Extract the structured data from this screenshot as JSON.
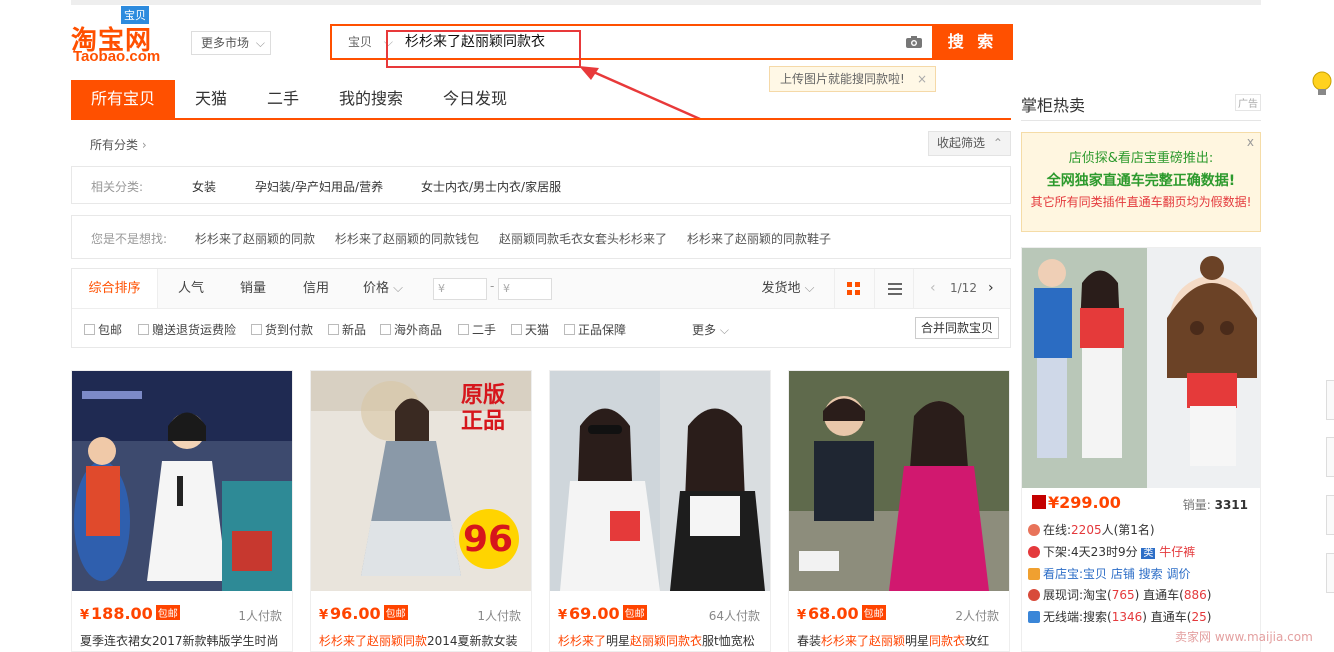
{
  "logo": {
    "cn": "淘宝网",
    "en": "Taobao.com",
    "tag": "宝贝"
  },
  "market_btn": "更多市场",
  "search": {
    "scope": "宝贝",
    "query": "杉杉来了赵丽颖同款衣",
    "button": "搜 索",
    "tip": "上传图片就能搜同款啦!",
    "tip_close": "×"
  },
  "tabs": [
    "所有宝贝",
    "天猫",
    "二手",
    "我的搜索",
    "今日发现"
  ],
  "crumb": "所有分类",
  "collapse": "收起筛选",
  "related": {
    "label": "相关分类:",
    "items": [
      "女装",
      "孕妇装/孕产妇用品/营养",
      "女士内衣/男士内衣/家居服"
    ]
  },
  "suggest": {
    "label": "您是不是想找:",
    "items": [
      "杉杉来了赵丽颖的同款",
      "杉杉来了赵丽颖的同款钱包",
      "赵丽颖同款毛衣女套头杉杉来了",
      "杉杉来了赵丽颖的同款鞋子"
    ]
  },
  "sort": {
    "items": [
      "综合排序",
      "人气",
      "销量",
      "信用",
      "价格"
    ],
    "price_min": "¥",
    "price_max": "¥",
    "dash": "-",
    "ship": "发货地",
    "page": "1/12",
    "filters": [
      "包邮",
      "赠送退货运费险",
      "货到付款",
      "新品",
      "海外商品",
      "二手",
      "天猫",
      "正品保障"
    ],
    "more": "更多",
    "merge": "合并同款宝贝"
  },
  "products": [
    {
      "price": "188.00",
      "free": "包邮",
      "sold": "1人付款",
      "title_a": "夏季连衣裙女2017新款韩版学生时尚",
      "title_hl": ""
    },
    {
      "price": "96.00",
      "free": "包邮",
      "sold": "1人付款",
      "title_hl": "杉杉来了赵丽颖同款",
      "title_a": "2014夏新款女装"
    },
    {
      "price": "69.00",
      "free": "包邮",
      "sold": "64人付款",
      "title_hl": "杉杉来了",
      "title_a": "明星",
      "title_hl2": "赵丽颖同款衣",
      "title_b": "服t恤宽松"
    },
    {
      "price": "68.00",
      "free": "包邮",
      "sold": "2人付款",
      "title_pre": "春装",
      "title_hl": "杉杉来了赵丽颖",
      "title_a": "明星",
      "title_hl2": "同款衣",
      "title_b": "玫红"
    }
  ],
  "product_overlay": {
    "badge_top": "原版",
    "badge_bottom": "正品",
    "big_number": "96"
  },
  "currency": "¥",
  "right": {
    "title": "掌柜热卖",
    "ad": "广告",
    "promo": {
      "l1": "店侦探&看店宝重磅推出:",
      "l2": "全网独家直通车完整正确数据!",
      "l3": "其它所有同类插件直通车翻页均为假数据!",
      "close": "x"
    },
    "price": "¥299.00",
    "sales_label": "销量:",
    "sales": "3311",
    "online": "在线:",
    "online_num": "2205",
    "online_rest": "人(第1名)",
    "offshelf": "下架:4天23时9分",
    "cat_tag": "类",
    "cat": "牛仔裤",
    "tools": "看店宝:宝贝 店铺 搜索 调价",
    "show": "展现词:淘宝(",
    "show_n1": "765",
    "show_mid": ") 直通车(",
    "show_n2": "886",
    "show_end": ")",
    "wireless": "无线端:搜索(",
    "wl_n1": "1346",
    "wl_mid": ") 直通车(",
    "wl_n2": "25",
    "wl_end": ")"
  },
  "watermark": "卖家网 www.maijia.com",
  "colors": {
    "accent": "#ff5000",
    "price": "#ff4400",
    "green": "#2d9a2d",
    "annotation": "#e8393a"
  }
}
